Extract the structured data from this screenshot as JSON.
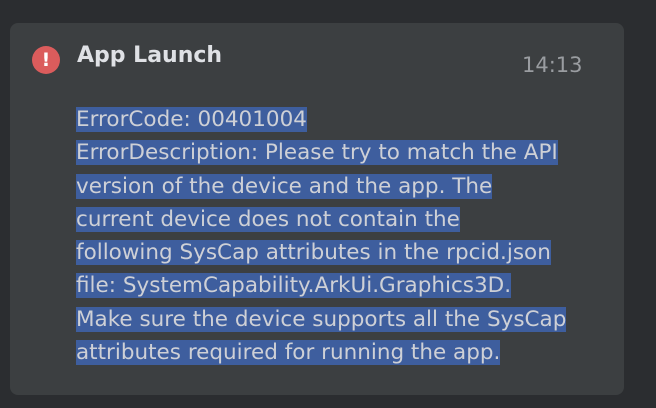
{
  "notification": {
    "icon": "error-icon",
    "icon_glyph": "!",
    "title": "App Launch",
    "time": "14:13",
    "selection_color": "#3e5e9e",
    "message_lines": [
      "ErrorCode: 00401004",
      "ErrorDescription: Please try to match the API",
      "version of the device and the app. The",
      "current device does not contain the",
      "following SysCap attributes in the rpcid.json",
      "file: SystemCapability.ArkUi.Graphics3D.",
      "Make sure the device supports all the SysCap",
      "attributes required for running the app."
    ]
  }
}
